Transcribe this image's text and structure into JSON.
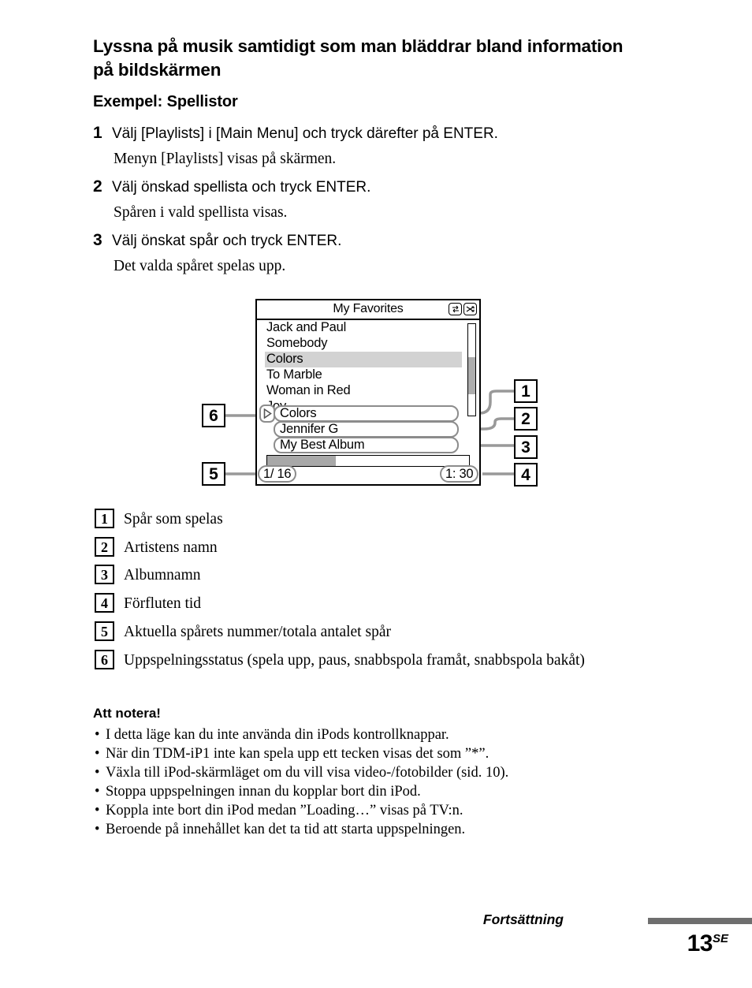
{
  "heading": {
    "title": "Lyssna på musik samtidigt som man bläddrar bland information på bildskärmen",
    "subtitle": "Exempel: Spellistor"
  },
  "steps": [
    {
      "number": "1",
      "instruction": "Välj [Playlists] i [Main Menu] och tryck därefter på ENTER.",
      "result": "Menyn [Playlists] visas på skärmen."
    },
    {
      "number": "2",
      "instruction": "Välj önskad spellista och tryck ENTER.",
      "result": "Spåren i vald spellista visas."
    },
    {
      "number": "3",
      "instruction": "Välj önskat spår och tryck ENTER.",
      "result": "Det valda spåret spelas upp."
    }
  ],
  "screen": {
    "title": "My Favorites",
    "icons": [
      "repeat-icon",
      "shuffle-icon"
    ],
    "tracks": [
      {
        "label": "Jack and Paul",
        "selected": false
      },
      {
        "label": "Somebody",
        "selected": false
      },
      {
        "label": "Colors",
        "selected": true
      },
      {
        "label": "To Marble",
        "selected": false
      },
      {
        "label": "Woman in Red",
        "selected": false
      },
      {
        "label": "Joy",
        "selected": false
      }
    ],
    "now_playing": {
      "track": "Colors",
      "artist": "Jennifer G",
      "album": "My Best Album",
      "play_state_icon": "play-icon"
    },
    "track_number": "1/ 16",
    "elapsed_time": "1: 30",
    "progress_percent": 34,
    "scroll_thumb_top_percent": 36,
    "scroll_thumb_height_percent": 41,
    "colors": {
      "selection": "#d2d2d2",
      "progress_fill": "#a8a8a8",
      "callout_outline": "#8c8c8c",
      "leader_line": "#999999"
    }
  },
  "callouts": [
    {
      "id": "1"
    },
    {
      "id": "2"
    },
    {
      "id": "3"
    },
    {
      "id": "4"
    },
    {
      "id": "5"
    },
    {
      "id": "6"
    }
  ],
  "legend": [
    {
      "number": "1",
      "text": "Spår som spelas"
    },
    {
      "number": "2",
      "text": "Artistens namn"
    },
    {
      "number": "3",
      "text": "Albumnamn"
    },
    {
      "number": "4",
      "text": "Förfluten tid"
    },
    {
      "number": "5",
      "text": "Aktuella spårets nummer/totala antalet spår"
    },
    {
      "number": "6",
      "text": "Uppspelningsstatus (spela upp, paus, snabbspola framåt, snabbspola bakåt)"
    }
  ],
  "notes": {
    "title": "Att notera!",
    "items": [
      "I detta läge kan du inte använda din iPods kontrollknappar.",
      "När din TDM-iP1 inte kan spela upp ett tecken visas det som ”*”.",
      "Växla till iPod-skärmläget om du vill visa video-/fotobilder (sid. 10).",
      "Stoppa uppspelningen innan du kopplar bort din iPod.",
      "Koppla inte bort din iPod medan ”Loading…” visas på TV:n.",
      "Beroende på innehållet kan det ta tid att starta uppspelningen."
    ]
  },
  "footer": {
    "continuation_label": "Fortsättning",
    "page_number": "13",
    "page_suffix": "SE"
  }
}
